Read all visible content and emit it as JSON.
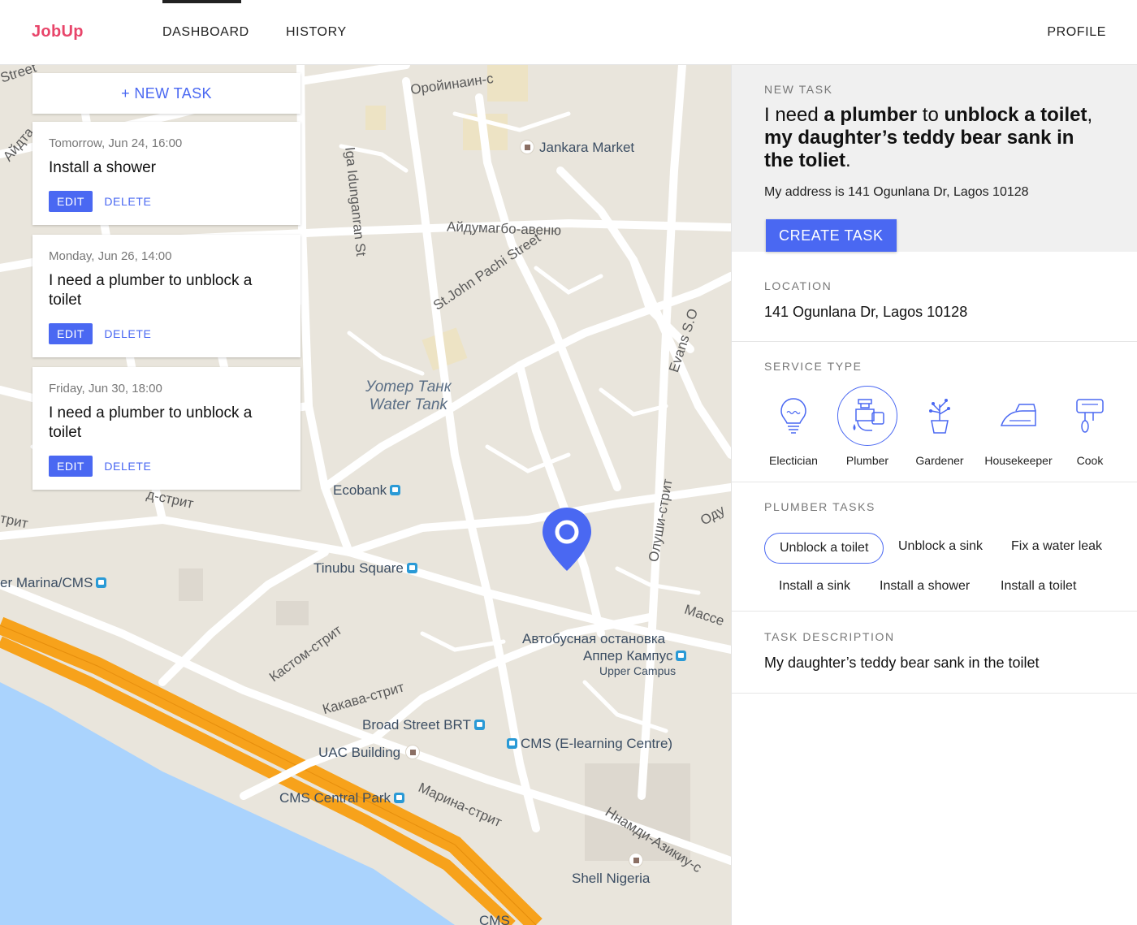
{
  "header": {
    "logo": "JobUp",
    "tabs": [
      {
        "label": "DASHBOARD",
        "active": true
      },
      {
        "label": "HISTORY",
        "active": false
      }
    ],
    "profile": "PROFILE"
  },
  "map": {
    "labels": {
      "jankara": "Jankara Market",
      "ecobank": "Ecobank",
      "tinubu": "Tinubu Square",
      "marina_cms": "er Marina/CMS",
      "water_tank_ru": "Уотер Танк",
      "water_tank_en": "Water Tank",
      "bus_stop": "Автобусная остановка",
      "upper_campus_ru": "Аппер Кампус",
      "upper_campus_en": "Upper Campus",
      "broad_street": "Broad Street BRT",
      "cms_elearning": "CMS (E-learning Centre)",
      "uac": "UAC Building",
      "cms_park": "CMS Central Park",
      "shell": "Shell Nigeria",
      "street_aydumagbo": "Айдумагбо-авеню",
      "street_stjohn": "St.John Pachi Street",
      "street_idunganran": "Iga Idunganran St",
      "street_orojinan": "Оройинаин-с",
      "street_evans": "Evans S.O",
      "street_olushi": "Олуши-стрит",
      "street_kastom": "Кастом-стрит",
      "street_kakava": "Какава-стрит",
      "street_marina": "Марина-стрит",
      "street_nnamdi": "Ннамди-Азикиу-с",
      "street_masse": "Массе",
      "street_ayd": "Айдта",
      "street_street": "Street",
      "street_dstrit": "д-стрит",
      "street_trit": "трит",
      "street_cms_bottom": "CMS",
      "street_odu": "Оду"
    }
  },
  "tasks": {
    "new_task_label": "+ NEW TASK",
    "items": [
      {
        "date": "Tomorrow, Jun 24, 16:00",
        "title": "Install a shower",
        "edit": "EDIT",
        "delete": "DELETE"
      },
      {
        "date": "Monday, Jun 26, 14:00",
        "title": "I need a plumber to unblock a toilet",
        "edit": "EDIT",
        "delete": "DELETE"
      },
      {
        "date": "Friday, Jun 30, 18:00",
        "title": "I need a plumber to unblock a toilet",
        "edit": "EDIT",
        "delete": "DELETE"
      }
    ]
  },
  "panel": {
    "new_task": {
      "label": "NEW TASK",
      "summary_parts": [
        "I need ",
        "a plumber",
        " to ",
        "unblock a toilet",
        ", ",
        "my daughter’s teddy bear sank in the toliet",
        "."
      ],
      "address": "My address is 141 Ogunlana Dr, Lagos 10128",
      "create_button": "CREATE TASK"
    },
    "location": {
      "label": "LOCATION",
      "value": "141 Ogunlana Dr, Lagos 10128"
    },
    "service_type": {
      "label": "SERVICE TYPE",
      "items": [
        {
          "name": "Electician",
          "icon": "lightbulb-icon",
          "selected": false
        },
        {
          "name": "Plumber",
          "icon": "plumber-icon",
          "selected": true
        },
        {
          "name": "Gardener",
          "icon": "plant-pot-icon",
          "selected": false
        },
        {
          "name": "Housekeeper",
          "icon": "iron-icon",
          "selected": false
        },
        {
          "name": "Cook",
          "icon": "mixer-icon",
          "selected": false
        }
      ]
    },
    "plumber_tasks": {
      "label": "PLUMBER TASKS",
      "items": [
        {
          "name": "Unblock a toilet",
          "selected": true
        },
        {
          "name": "Unblock a sink",
          "selected": false
        },
        {
          "name": "Fix a water leak",
          "selected": false
        },
        {
          "name": "Install a sink",
          "selected": false
        },
        {
          "name": "Install a shower",
          "selected": false
        },
        {
          "name": "Install a toilet",
          "selected": false
        }
      ]
    },
    "description": {
      "label": "TASK DESCRIPTION",
      "value": "My daughter’s teddy bear sank in the toilet"
    }
  },
  "colors": {
    "accent": "#4a68f2",
    "brand": "#e8456a",
    "map_land": "#e9e5dc",
    "map_road": "#ffffff",
    "map_water": "#aad3fd",
    "highway": "#f7a21b"
  }
}
